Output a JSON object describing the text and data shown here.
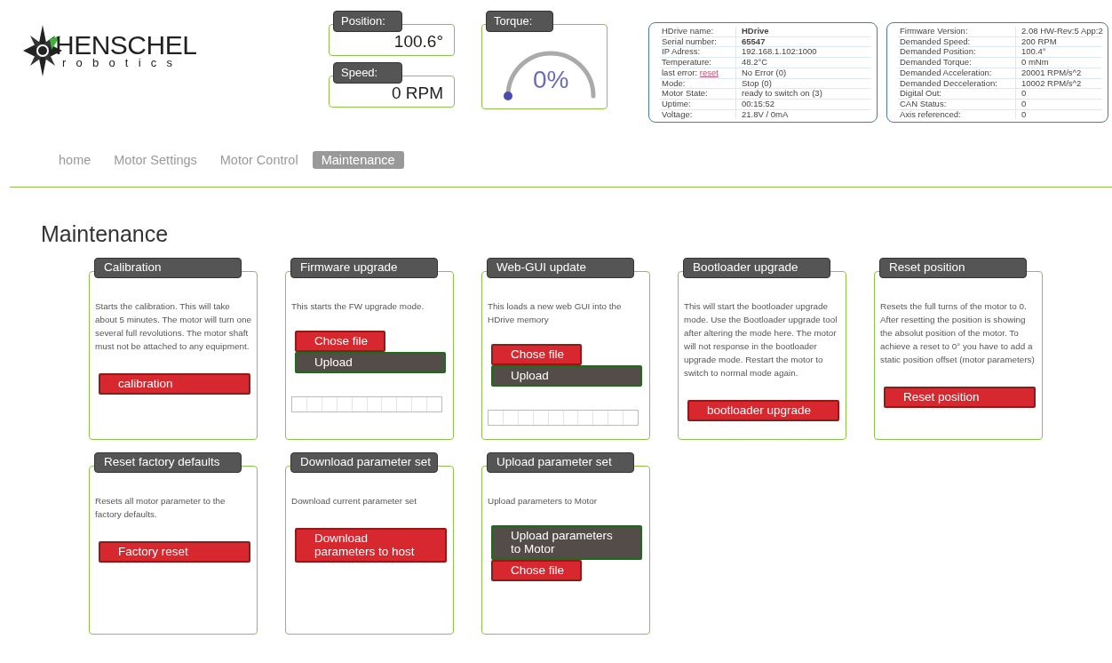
{
  "logo": {
    "name": "HENSCHEL",
    "tagline": "robotics"
  },
  "readouts": [
    {
      "label": "Position:",
      "value": "100.6°"
    },
    {
      "label": "Speed:",
      "value": "0 RPM"
    }
  ],
  "torque": {
    "label": "Torque:",
    "value": "0%"
  },
  "info_tables": [
    {
      "rows": [
        {
          "label": "HDrive name:",
          "value": "HDrive",
          "bold": true
        },
        {
          "label": "Serial number:",
          "value": "65547",
          "bold": true
        },
        {
          "label": "IP Adress:",
          "value": "192.168.1.102:1000",
          "bold": false
        },
        {
          "label": "Temperature:",
          "value": "48.2°C",
          "bold": false
        },
        {
          "label": "last error:",
          "link": "reset",
          "value": "No Error (0)",
          "bold": false
        },
        {
          "label": "Mode:",
          "value": "Stop (0)",
          "bold": false
        },
        {
          "label": "Motor State:",
          "value": "ready to switch on (3)",
          "bold": false
        },
        {
          "label": "Uptime:",
          "value": "00:15:52",
          "bold": false
        },
        {
          "label": "Voltage:",
          "value": "21.8V / 0mA",
          "bold": false
        }
      ]
    },
    {
      "rows": [
        {
          "label": "Firmware Version:",
          "value": "2.08 HW-Rev:5 App:2",
          "bold": false
        },
        {
          "label": "Demanded Speed:",
          "value": "200 RPM",
          "bold": false
        },
        {
          "label": "Demanded Position:",
          "value": "100.4°",
          "bold": false
        },
        {
          "label": "Demanded Torque:",
          "value": "0 mNm",
          "bold": false
        },
        {
          "label": "Demanded Acceleration:",
          "value": "20001 RPM/s^2",
          "bold": false
        },
        {
          "label": "Demanded Decceleration:",
          "value": "10002 RPM/s^2",
          "bold": false
        },
        {
          "label": "Digital Out:",
          "value": "0",
          "bold": false
        },
        {
          "label": "CAN Status:",
          "value": "0",
          "bold": false
        },
        {
          "label": "Axis referenced:",
          "value": "0",
          "bold": false
        }
      ]
    }
  ],
  "nav": [
    {
      "label": "home",
      "selected": false
    },
    {
      "label": "Motor Settings",
      "selected": false
    },
    {
      "label": "Motor Control",
      "selected": false
    },
    {
      "label": "Maintenance",
      "selected": true
    }
  ],
  "heading": "Maintenance",
  "cards": [
    {
      "title": "Calibration",
      "description": "Starts the calibration. This will take about 5 minutes. The motor will turn one several full revolutions. The motor shaft must not be attached to any equipment.",
      "controls": [
        {
          "kind": "action",
          "label": "calibration"
        }
      ]
    },
    {
      "title": "Firmware upgrade",
      "description": "This starts the FW upgrade mode.",
      "controls": [
        {
          "kind": "file",
          "label": "Chose file"
        },
        {
          "kind": "submit",
          "label": "Upload"
        },
        {
          "kind": "progress",
          "level": 0
        }
      ]
    },
    {
      "title": "Web-GUI update",
      "description": "This loads a new web GUI into the HDrive memory",
      "controls": [
        {
          "kind": "file",
          "label": "Chose file"
        },
        {
          "kind": "submit",
          "label": "Upload"
        },
        {
          "kind": "progress",
          "level": 0
        }
      ]
    },
    {
      "title": "Bootloader upgrade",
      "description": "This will start the bootloader upgrade mode. Use the Bootloader upgrade tool after altering the mode here. The motor will not response in the bootloader upgrade mode. Restart the motor to switch to normal mode again.",
      "controls": [
        {
          "kind": "action",
          "label": "bootloader upgrade"
        }
      ]
    },
    {
      "title": "Reset position",
      "description": "Resets the full turns of the motor to 0. After resetting the position is showing the absolut position of the motor. To achieve a reset to 0° you have to add a static position offset (motor parameters)",
      "controls": [
        {
          "kind": "action",
          "label": "Reset position"
        }
      ]
    },
    {
      "title": "Reset factory defaults",
      "description": "Resets all motor parameter to the factory defaults.",
      "controls": [
        {
          "kind": "action",
          "label": "Factory reset"
        }
      ]
    },
    {
      "title": "Download parameter set",
      "description": "Download current parameter set",
      "controls": [
        {
          "kind": "action",
          "label": "Download parameters to host"
        }
      ]
    },
    {
      "title": "Upload parameter set",
      "description": "Upload parameters to Motor",
      "controls": [
        {
          "kind": "submit",
          "label": "Upload parameters to Motor"
        },
        {
          "kind": "file",
          "label": "Chose file"
        }
      ]
    }
  ]
}
